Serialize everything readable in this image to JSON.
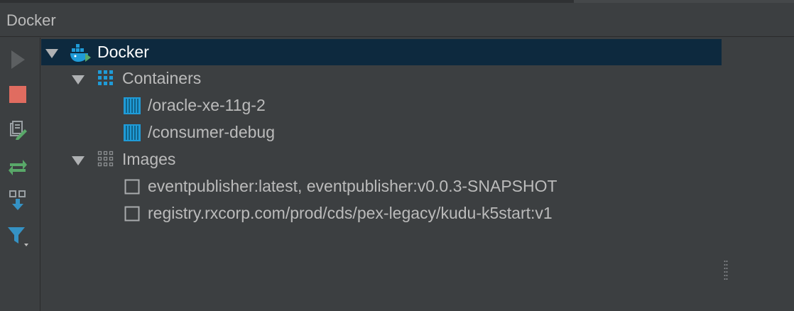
{
  "window": {
    "title": "Docker"
  },
  "toolbar": {
    "items": [
      {
        "icon": "play-icon",
        "state": "disabled"
      },
      {
        "icon": "stop-icon",
        "state": "enabled"
      },
      {
        "icon": "edit-config-icon",
        "state": "enabled"
      },
      {
        "icon": "redeploy-icon",
        "state": "enabled"
      },
      {
        "icon": "pull-image-icon",
        "state": "enabled"
      },
      {
        "icon": "filter-icon",
        "state": "enabled"
      }
    ]
  },
  "tree": {
    "root": {
      "label": "Docker",
      "expanded": true,
      "selected": true
    },
    "containers": {
      "label": "Containers",
      "expanded": true,
      "items": [
        {
          "label": "/oracle-xe-11g-2"
        },
        {
          "label": "/consumer-debug"
        }
      ]
    },
    "images": {
      "label": "Images",
      "expanded": true,
      "items": [
        {
          "label": "eventpublisher:latest, eventpublisher:v0.0.3-SNAPSHOT"
        },
        {
          "label": "registry.rxcorp.com/prod/cds/pex-legacy/kudu-k5start:v1"
        }
      ]
    }
  },
  "colors": {
    "background": "#3c3f41",
    "selection": "#0d293e",
    "container_icon": "#1f9bd7",
    "stop_red": "#e06c60",
    "green": "#59a869",
    "blue": "#3592c4"
  }
}
